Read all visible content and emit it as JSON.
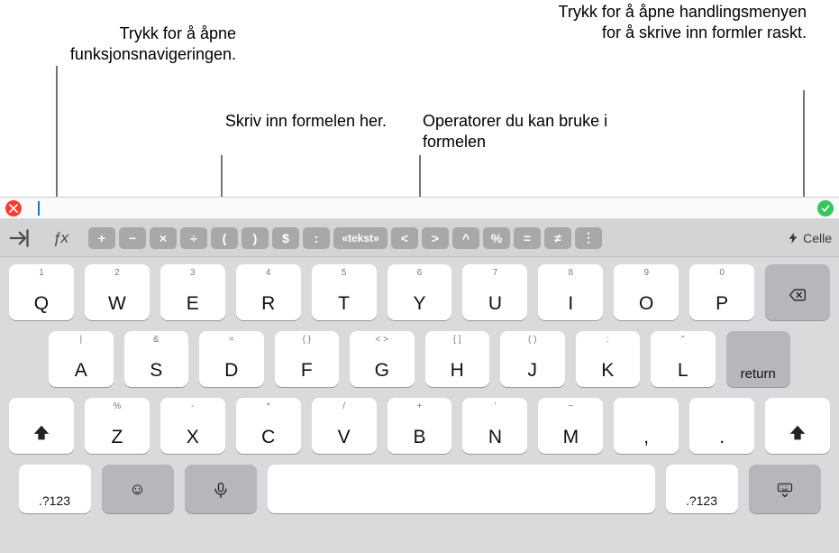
{
  "callouts": {
    "fx": "Trykk for å åpne funksjonsnavigeringen.",
    "formula_input": "Skriv inn formelen her.",
    "operators": "Operatorer du kan bruke i formelen",
    "celle": "Trykk for å åpne handlingsmenyen for å skrive inn formler raskt."
  },
  "toolbar": {
    "fx_label": "ƒx",
    "celle_label": "Celle",
    "operators": [
      {
        "id": "plus",
        "label": "+"
      },
      {
        "id": "minus",
        "label": "−"
      },
      {
        "id": "mult",
        "label": "×"
      },
      {
        "id": "div",
        "label": "÷"
      },
      {
        "id": "lparen",
        "label": "("
      },
      {
        "id": "rparen",
        "label": ")"
      },
      {
        "id": "dollar",
        "label": "$"
      },
      {
        "id": "colon",
        "label": ":"
      },
      {
        "id": "text",
        "label": "«tekst»",
        "wide": true
      },
      {
        "id": "lt",
        "label": "<"
      },
      {
        "id": "gt",
        "label": ">"
      },
      {
        "id": "caret",
        "label": "^"
      },
      {
        "id": "percent",
        "label": "%"
      },
      {
        "id": "eq",
        "label": "="
      },
      {
        "id": "neq",
        "label": "≠"
      },
      {
        "id": "more",
        "label": "⋮"
      }
    ]
  },
  "keyboard": {
    "row1": [
      {
        "sub": "1",
        "main": "Q"
      },
      {
        "sub": "2",
        "main": "W"
      },
      {
        "sub": "3",
        "main": "E"
      },
      {
        "sub": "4",
        "main": "R"
      },
      {
        "sub": "5",
        "main": "T"
      },
      {
        "sub": "6",
        "main": "Y"
      },
      {
        "sub": "7",
        "main": "U"
      },
      {
        "sub": "8",
        "main": "I"
      },
      {
        "sub": "9",
        "main": "O"
      },
      {
        "sub": "0",
        "main": "P"
      }
    ],
    "row2": [
      {
        "sub": "|",
        "main": "A"
      },
      {
        "sub": "&",
        "main": "S"
      },
      {
        "sub": "=",
        "main": "D"
      },
      {
        "sub": "{ }",
        "main": "F"
      },
      {
        "sub": "< >",
        "main": "G"
      },
      {
        "sub": "[ ]",
        "main": "H"
      },
      {
        "sub": "( )",
        "main": "J"
      },
      {
        "sub": ":",
        "main": "K"
      },
      {
        "sub": "\"",
        "main": "L"
      }
    ],
    "row3": [
      {
        "sub": "%",
        "main": "Z"
      },
      {
        "sub": "-",
        "main": "X"
      },
      {
        "sub": "*",
        "main": "C"
      },
      {
        "sub": "/",
        "main": "V"
      },
      {
        "sub": "+",
        "main": "B"
      },
      {
        "sub": "'",
        "main": "N"
      },
      {
        "sub": "~",
        "main": "M"
      },
      {
        "sub": "",
        "main": ","
      },
      {
        "sub": "",
        "main": "."
      }
    ],
    "bottom": {
      "num_left": ".?123",
      "num_right": ".?123",
      "return": "return"
    },
    "row2_return": "return"
  }
}
